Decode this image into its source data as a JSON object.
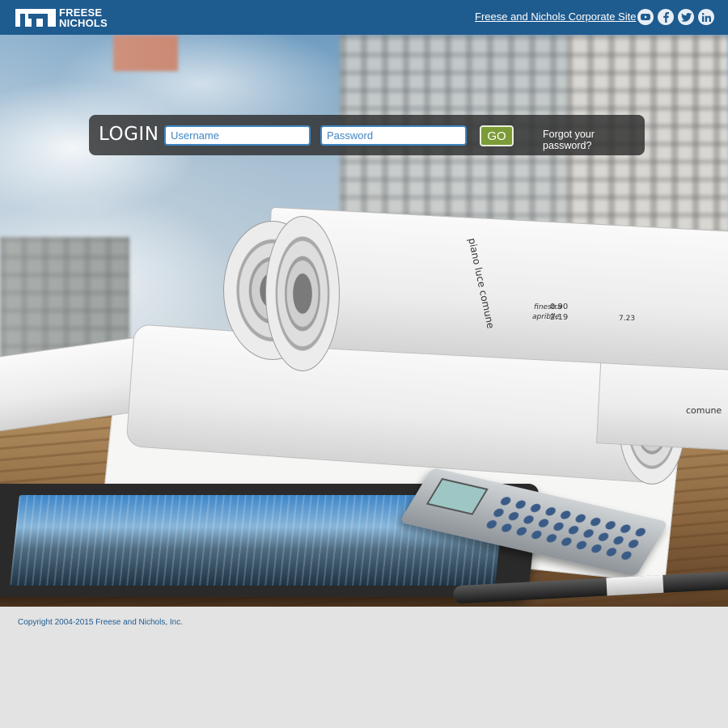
{
  "header": {
    "logo_line1": "FREESE",
    "logo_line2": "NICHOLS",
    "corporate_link": "Freese and Nichols Corporate Site",
    "social": [
      {
        "name": "youtube-icon"
      },
      {
        "name": "facebook-icon"
      },
      {
        "name": "twitter-icon"
      },
      {
        "name": "linkedin-icon"
      }
    ],
    "bar_color": "#1e5b8f"
  },
  "login": {
    "label": "LOGIN",
    "username_placeholder": "Username",
    "password_placeholder": "Password",
    "go_label": "GO",
    "forgot_label": "Forgot your password?",
    "accent_color": "#3f86c3",
    "go_color": "#7b9b37"
  },
  "blueprint": {
    "t1": "piano luce comune",
    "t2": "finestra",
    "t3": "apribile",
    "t4": "0.90",
    "t5": "2.19",
    "t6": "7.23",
    "t7": "comune"
  },
  "footer": {
    "copyright": "Copyright 2004-2015 Freese and Nichols, Inc."
  }
}
